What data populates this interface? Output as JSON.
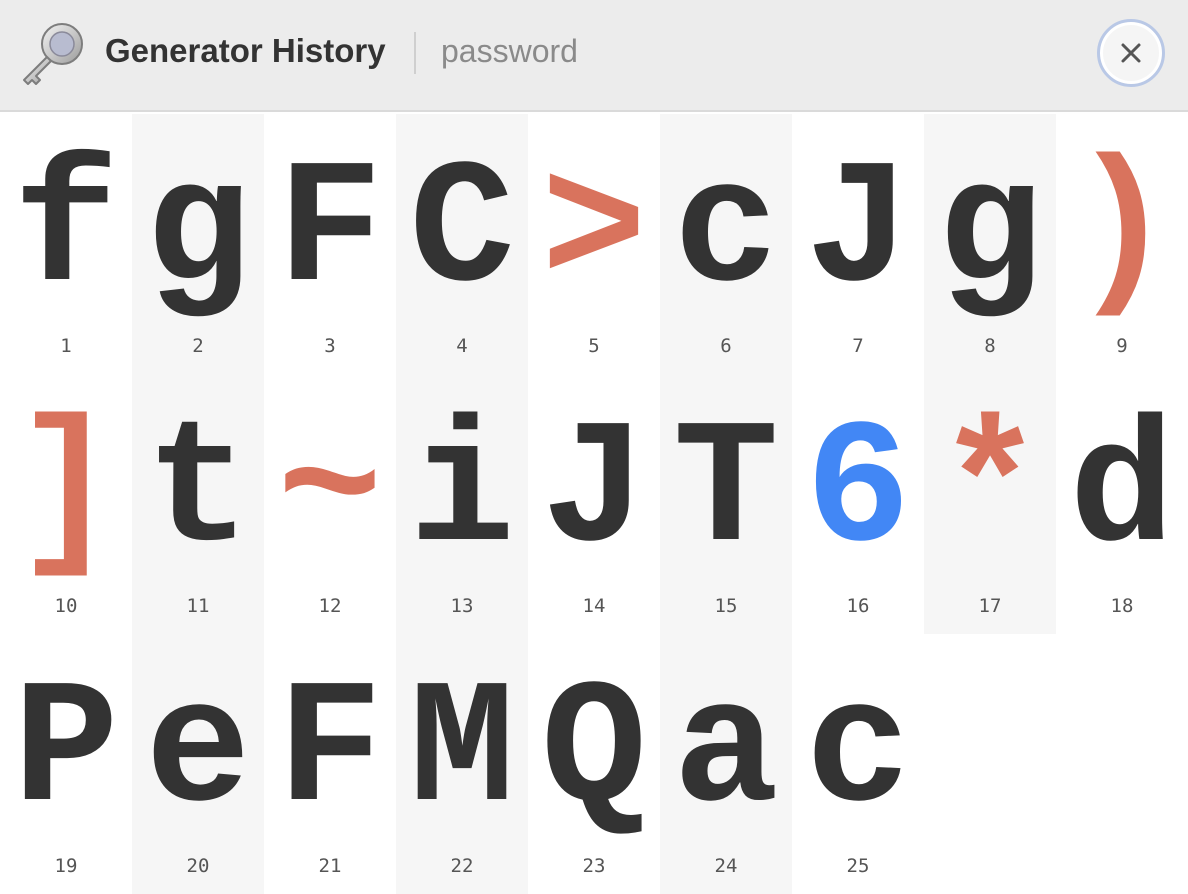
{
  "header": {
    "title": "Generator History",
    "subtitle": "password",
    "icon": "key-icon",
    "close_icon": "close-icon"
  },
  "colors": {
    "letter": "#333333",
    "symbol": "#d9735d",
    "digit": "#4287f5",
    "header_bg": "#ececec",
    "shaded_cell": "#f6f6f6"
  },
  "characters": [
    {
      "char": "f",
      "index": "1",
      "kind": "letter"
    },
    {
      "char": "g",
      "index": "2",
      "kind": "letter"
    },
    {
      "char": "F",
      "index": "3",
      "kind": "letter"
    },
    {
      "char": "C",
      "index": "4",
      "kind": "letter"
    },
    {
      "char": ">",
      "index": "5",
      "kind": "symbol"
    },
    {
      "char": "c",
      "index": "6",
      "kind": "letter"
    },
    {
      "char": "J",
      "index": "7",
      "kind": "letter"
    },
    {
      "char": "g",
      "index": "8",
      "kind": "letter"
    },
    {
      "char": ")",
      "index": "9",
      "kind": "symbol"
    },
    {
      "char": "]",
      "index": "10",
      "kind": "symbol"
    },
    {
      "char": "t",
      "index": "11",
      "kind": "letter"
    },
    {
      "char": "~",
      "index": "12",
      "kind": "symbol"
    },
    {
      "char": "i",
      "index": "13",
      "kind": "letter"
    },
    {
      "char": "J",
      "index": "14",
      "kind": "letter"
    },
    {
      "char": "T",
      "index": "15",
      "kind": "letter"
    },
    {
      "char": "6",
      "index": "16",
      "kind": "digit"
    },
    {
      "char": "*",
      "index": "17",
      "kind": "symbol"
    },
    {
      "char": "d",
      "index": "18",
      "kind": "letter"
    },
    {
      "char": "P",
      "index": "19",
      "kind": "letter"
    },
    {
      "char": "e",
      "index": "20",
      "kind": "letter"
    },
    {
      "char": "F",
      "index": "21",
      "kind": "letter"
    },
    {
      "char": "M",
      "index": "22",
      "kind": "letter"
    },
    {
      "char": "Q",
      "index": "23",
      "kind": "letter"
    },
    {
      "char": "a",
      "index": "24",
      "kind": "letter"
    },
    {
      "char": "c",
      "index": "25",
      "kind": "letter"
    }
  ]
}
